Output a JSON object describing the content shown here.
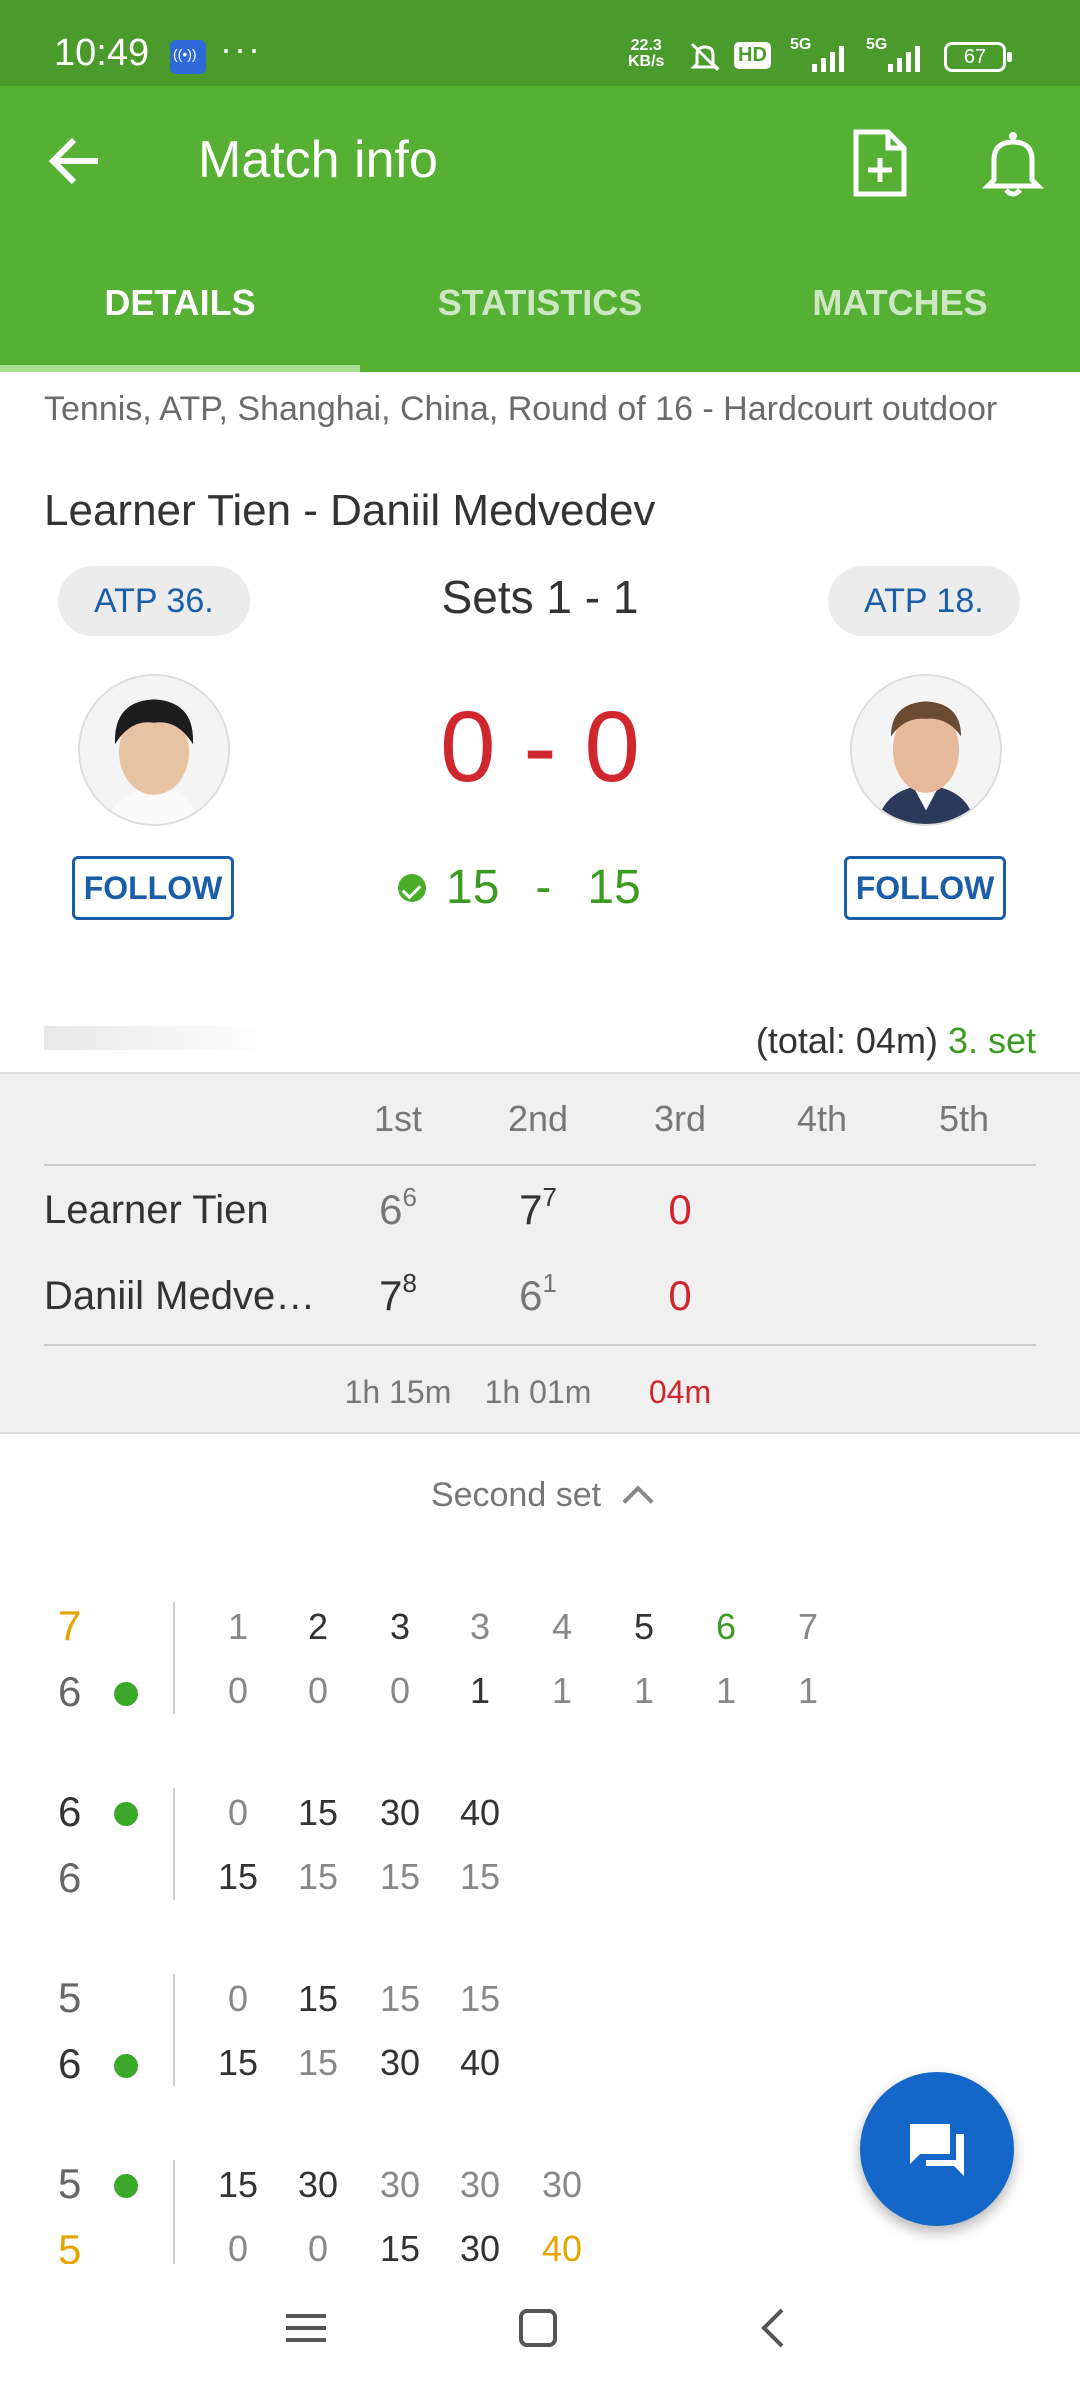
{
  "status_bar": {
    "time": "10:49",
    "dots": "···",
    "net_speed_top": "22.3",
    "net_speed_bottom": "KB/s",
    "hd_label": "HD",
    "signal1": "5G",
    "signal2": "5G",
    "battery": "67"
  },
  "app_bar": {
    "title": "Match info"
  },
  "tabs": [
    {
      "label": "DETAILS",
      "active": true
    },
    {
      "label": "STATISTICS",
      "active": false
    },
    {
      "label": "MATCHES",
      "active": false
    }
  ],
  "match": {
    "breadcrumb": "Tennis, ATP, Shanghai, China, Round of 16 - Hardcourt outdoor",
    "title": "Learner Tien - Daniil Medvedev",
    "sets_summary": "Sets 1 - 1",
    "score": "0 - 0",
    "point_home": "15",
    "point_sep": "-",
    "point_away": "15",
    "home": {
      "rank": "ATP 36.",
      "follow": "FOLLOW"
    },
    "away": {
      "rank": "ATP 18.",
      "follow": "FOLLOW"
    },
    "total": "(total: 04m)",
    "current_set": "3. set"
  },
  "set_table": {
    "headers": [
      "1st",
      "2nd",
      "3rd",
      "4th",
      "5th"
    ],
    "rows": [
      {
        "name": "Learner Tien",
        "s1": "6",
        "s1_tb": "6",
        "s2": "7",
        "s2_tb": "7",
        "s3": "0"
      },
      {
        "name": "Daniil Medvedev",
        "s1": "7",
        "s1_tb": "8",
        "s2": "6",
        "s2_tb": "1",
        "s3": "0"
      }
    ],
    "durations": [
      "1h 15m",
      "1h 01m",
      "04m"
    ]
  },
  "set_toggle_label": "Second set",
  "games": [
    {
      "top_score": "7",
      "bottom_score": "6",
      "top": [
        "1",
        "2",
        "3",
        "3",
        "4",
        "5",
        "6",
        "7"
      ],
      "bottom": [
        "0",
        "0",
        "0",
        "1",
        "1",
        "1",
        "1",
        "1"
      ]
    },
    {
      "top_score": "6",
      "bottom_score": "6",
      "top": [
        "0",
        "15",
        "30",
        "40"
      ],
      "bottom": [
        "15",
        "15",
        "15",
        "15"
      ]
    },
    {
      "top_score": "5",
      "bottom_score": "6",
      "top": [
        "0",
        "15",
        "15",
        "15"
      ],
      "bottom": [
        "15",
        "15",
        "30",
        "40"
      ]
    },
    {
      "top_score": "5",
      "bottom_score": "5",
      "top": [
        "15",
        "30",
        "30",
        "30",
        "30"
      ],
      "bottom": [
        "0",
        "0",
        "15",
        "30",
        "40"
      ]
    }
  ],
  "colors": {
    "header_green": "#55b033",
    "status_green": "#4a9b2b",
    "score_red": "#d0262e",
    "point_green": "#3d9a22",
    "link_blue": "#1a5ea8",
    "fab_blue": "#1466c8",
    "gold": "#e6a400"
  },
  "icons": [
    "cast-icon",
    "mute-icon",
    "hd-icon",
    "signal-icon",
    "battery-icon",
    "back-arrow-icon",
    "add-document-icon",
    "bell-icon",
    "tennis-ball-icon",
    "chevron-up-icon",
    "chat-icon",
    "menu-icon",
    "home-icon",
    "back-nav-icon"
  ]
}
